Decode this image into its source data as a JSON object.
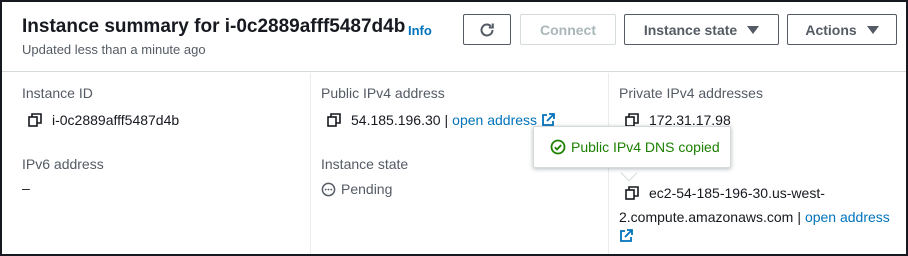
{
  "header": {
    "title": "Instance summary for i-0c2889afff5487d4b",
    "info_label": "Info",
    "subtitle": "Updated less than a minute ago",
    "buttons": {
      "refresh_icon": "refresh-icon",
      "connect_label": "Connect",
      "instance_state_label": "Instance state",
      "actions_label": "Actions"
    }
  },
  "details": {
    "instance_id": {
      "label": "Instance ID",
      "value": "i-0c2889afff5487d4b"
    },
    "public_ipv4": {
      "label": "Public IPv4 address",
      "value": "54.185.196.30",
      "separator": "|",
      "link": "open address"
    },
    "private_ipv4": {
      "label": "Private IPv4 addresses",
      "value": "172.31.17.98"
    },
    "ipv6": {
      "label": "IPv6 address",
      "value": "–"
    },
    "instance_state": {
      "label": "Instance state",
      "value": "Pending"
    },
    "public_dns": {
      "value_line1": "ec2-54-185-196-30.us-west-",
      "value_line2": "2.compute.amazonaws.com",
      "separator": "|",
      "link": "open address"
    }
  },
  "tooltip": {
    "text": "Public IPv4 DNS copied"
  },
  "colors": {
    "link": "#0073bb",
    "success": "#1d8102",
    "label": "#545b64",
    "text": "#16191f",
    "disabled": "#aab7b8"
  }
}
